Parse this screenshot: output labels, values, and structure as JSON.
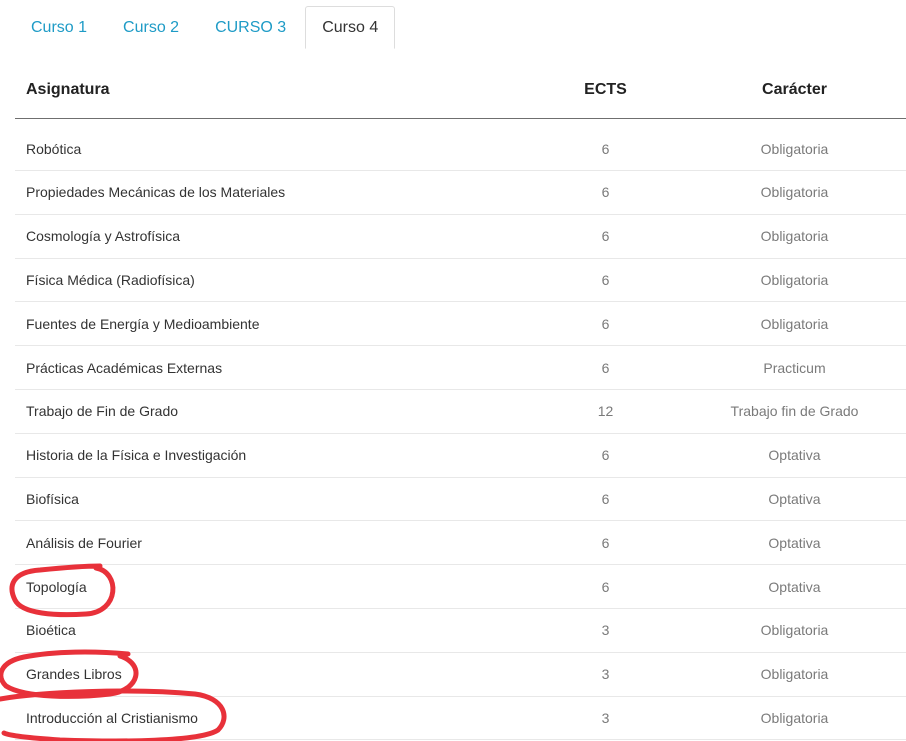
{
  "tabs": [
    {
      "label": "Curso 1",
      "active": false
    },
    {
      "label": "Curso 2",
      "active": false
    },
    {
      "label": "CURSO 3",
      "active": false
    },
    {
      "label": "Curso 4",
      "active": true
    }
  ],
  "table": {
    "headers": {
      "subject": "Asignatura",
      "ects": "ECTS",
      "type": "Carácter"
    },
    "rows": [
      {
        "subject": "Robótica",
        "ects": "6",
        "type": "Obligatoria"
      },
      {
        "subject": "Propiedades Mecánicas de los Materiales",
        "ects": "6",
        "type": "Obligatoria"
      },
      {
        "subject": "Cosmología y Astrofísica",
        "ects": "6",
        "type": "Obligatoria"
      },
      {
        "subject": "Física Médica (Radiofísica)",
        "ects": "6",
        "type": "Obligatoria"
      },
      {
        "subject": "Fuentes de Energía y Medioambiente",
        "ects": "6",
        "type": "Obligatoria"
      },
      {
        "subject": "Prácticas Académicas Externas",
        "ects": "6",
        "type": "Practicum"
      },
      {
        "subject": "Trabajo de Fin de Grado",
        "ects": "12",
        "type": "Trabajo fin de Grado"
      },
      {
        "subject": "Historia de la Física e Investigación",
        "ects": "6",
        "type": "Optativa"
      },
      {
        "subject": "Biofísica",
        "ects": "6",
        "type": "Optativa"
      },
      {
        "subject": "Análisis de Fourier",
        "ects": "6",
        "type": "Optativa"
      },
      {
        "subject": "Topología",
        "ects": "6",
        "type": "Optativa"
      },
      {
        "subject": "Bioética",
        "ects": "3",
        "type": "Obligatoria"
      },
      {
        "subject": "Grandes Libros",
        "ects": "3",
        "type": "Obligatoria"
      },
      {
        "subject": "Introducción al Cristianismo",
        "ects": "3",
        "type": "Obligatoria"
      }
    ]
  },
  "annotation": {
    "color": "#e8313a"
  }
}
